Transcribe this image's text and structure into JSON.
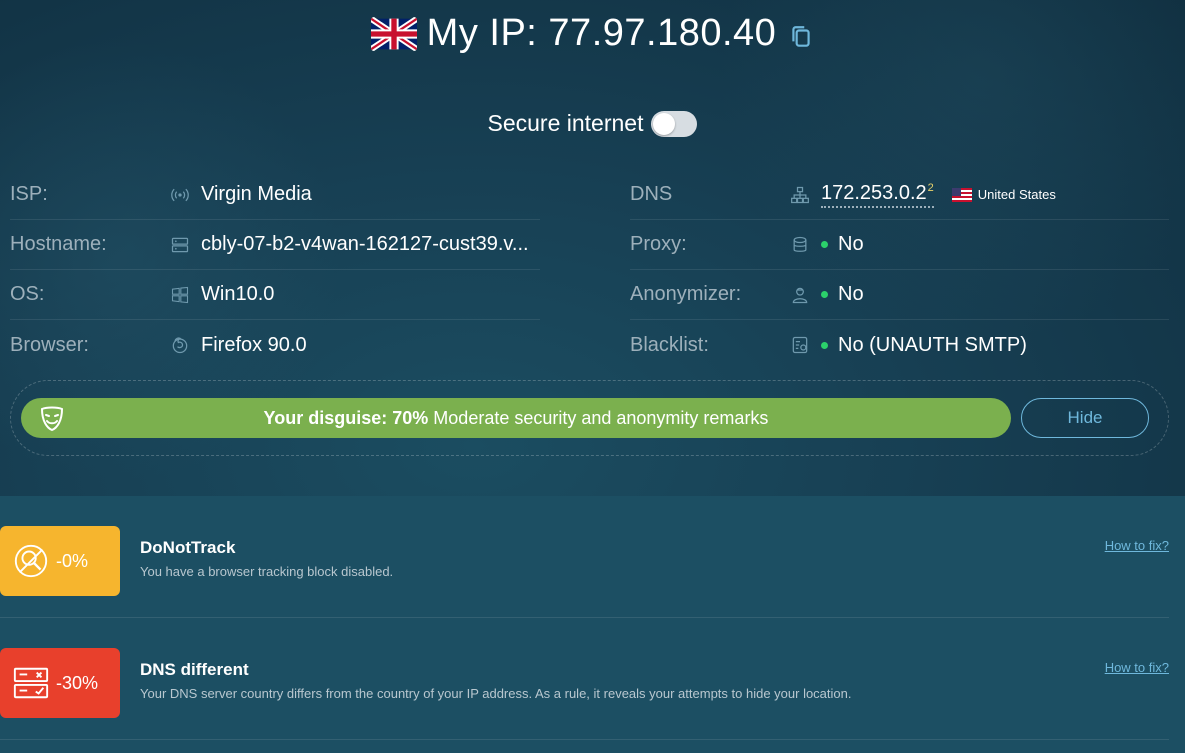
{
  "header": {
    "ip_prefix": "My IP:",
    "ip_address": "77.97.180.40"
  },
  "secure": {
    "label": "Secure internet",
    "enabled": false
  },
  "left_info": [
    {
      "label": "ISP:",
      "value": "Virgin Media",
      "icon": "antenna-icon"
    },
    {
      "label": "Hostname:",
      "value": "cbly-07-b2-v4wan-162127-cust39.v...",
      "icon": "server-icon"
    },
    {
      "label": "OS:",
      "value": "Win10.0",
      "icon": "windows-icon"
    },
    {
      "label": "Browser:",
      "value": "Firefox 90.0",
      "icon": "firefox-icon"
    }
  ],
  "right_info": {
    "dns": {
      "label": "DNS",
      "value": "172.253.0.2",
      "count": "2",
      "country": "United States"
    },
    "proxy": {
      "label": "Proxy:",
      "value": "No"
    },
    "anonymizer": {
      "label": "Anonymizer:",
      "value": "No"
    },
    "blacklist": {
      "label": "Blacklist:",
      "value": "No (UNAUTH SMTP)"
    }
  },
  "disguise": {
    "prefix": "Your disguise:",
    "percent": "70%",
    "remark": "Moderate security and anonymity remarks",
    "level": 0.7,
    "hide_label": "Hide"
  },
  "issues": [
    {
      "badge": "-0%",
      "title": "DoNotTrack",
      "description": "You have a browser tracking block disabled.",
      "fix_label": "How to fix?",
      "color": "#f6b52e"
    },
    {
      "badge": "-30%",
      "title": "DNS different",
      "description": "Your DNS server country differs from the country of your IP address. As a rule, it reveals your attempts to hide your location.",
      "fix_label": "How to fix?",
      "color": "#e8402c"
    }
  ],
  "colors": {
    "accent": "#6fb8dc",
    "good": "#2bd06b",
    "disguise": "#7bb04e",
    "bg_dark": "#102f40",
    "bg_panel": "#1c4f63"
  }
}
